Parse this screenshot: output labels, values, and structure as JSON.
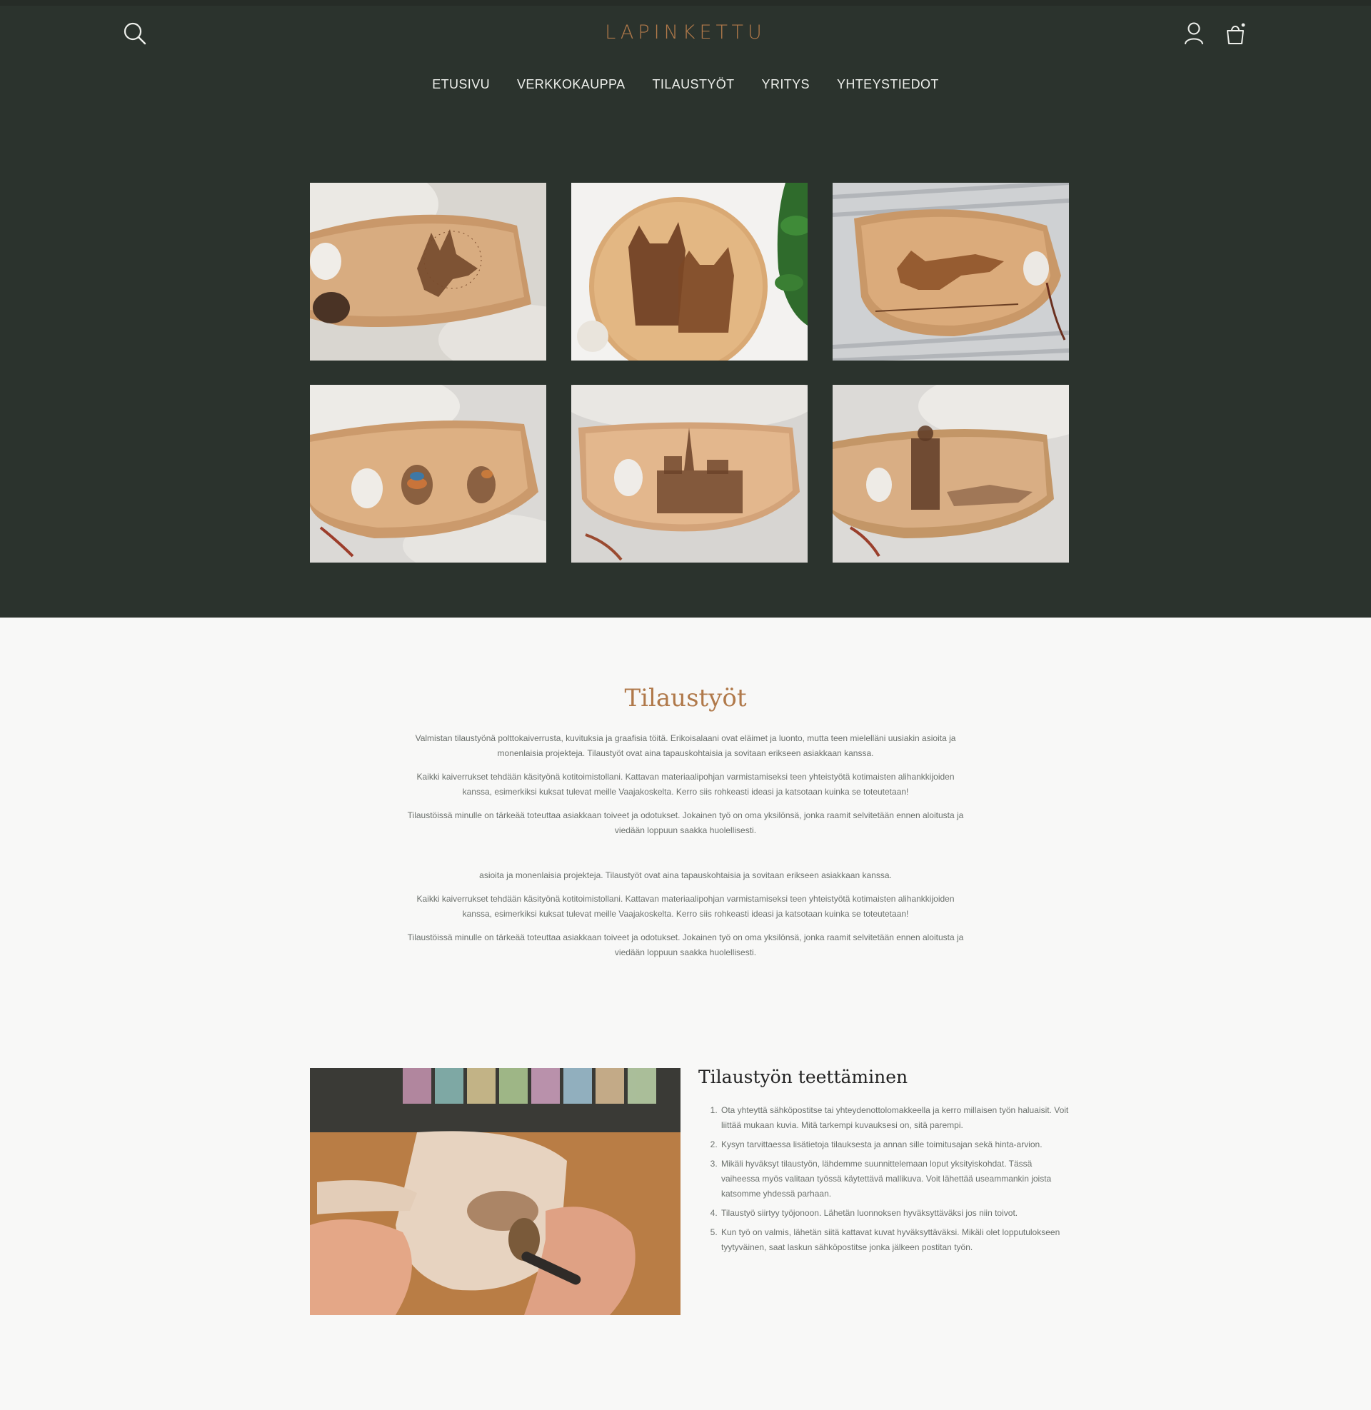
{
  "header": {
    "logo": "LAPINKETTU",
    "search_icon": "search-icon",
    "account_icon": "user-icon",
    "cart_icon": "shopping-bag-icon",
    "colors": {
      "background": "#2b332d",
      "accent": "#b0794a",
      "nav_text": "#eef0ec"
    }
  },
  "nav": {
    "items": [
      {
        "label": "ETUSIVU"
      },
      {
        "label": "VERKKOKAUPPA"
      },
      {
        "label": "TILAUSTYÖT"
      },
      {
        "label": "YRITYS"
      },
      {
        "label": "YHTEYSTIEDOT"
      }
    ]
  },
  "gallery": {
    "images": [
      {
        "subject": "kuksa-dog-engraving"
      },
      {
        "subject": "round-board-two-dogs"
      },
      {
        "subject": "kuksa-fox-running"
      },
      {
        "subject": "kuksa-two-birds"
      },
      {
        "subject": "kuksa-cathedral"
      },
      {
        "subject": "kuksa-hunter-and-dog"
      }
    ]
  },
  "intro": {
    "title": "Tilaustyöt",
    "p1": "Valmistan tilaustyönä polttokaiverrusta, kuvituksia ja graafisia töitä. Erikoisalaani ovat eläimet ja luonto, mutta teen mielelläni uusiakin asioita ja monenlaisia projekteja. Tilaustyöt ovat aina tapauskohtaisia ja sovitaan erikseen asiakkaan kanssa.",
    "p2": "Kaikki kaiverrukset tehdään käsityönä kotitoimistollani. Kattavan materiaalipohjan varmistamiseksi teen yhteistyötä kotimaisten alihankkijoiden kanssa, esimerkiksi kuksat tulevat meille Vaajakoskelta. Kerro siis rohkeasti ideasi ja katsotaan kuinka se toteutetaan!",
    "p3": "Tilaustöissä minulle on tärkeää toteuttaa asiakkaan toiveet ja odotukset. Jokainen työ on oma yksilönsä, jonka raamit selvitetään ennen aloitusta ja viedään loppuun saakka huolellisesti.",
    "p4": "asioita ja monenlaisia projekteja. Tilaustyöt ovat aina tapauskohtaisia ja sovitaan erikseen asiakkaan kanssa.",
    "p5": "Kaikki kaiverrukset tehdään käsityönä kotitoimistollani. Kattavan materiaalipohjan varmistamiseksi teen yhteistyötä kotimaisten alihankkijoiden kanssa, esimerkiksi kuksat tulevat meille Vaajakoskelta. Kerro siis rohkeasti ideasi ja katsotaan kuinka se toteutetaan!",
    "p6": "Tilaustöissä minulle on tärkeää toteuttaa asiakkaan toiveet ja odotukset. Jokainen työ on oma yksilönsä, jonka raamit selvitetään ennen aloitusta ja viedään loppuun saakka huolellisesti."
  },
  "process": {
    "title": "Tilaustyön teettäminen",
    "steps": [
      "Ota yhteyttä sähköpostitse tai yhteydenottolomakkeella ja kerro millaisen työn haluaisit. Voit liittää mukaan kuvia. Mitä tarkempi kuvauksesi on, sitä parempi.",
      "Kysyn tarvittaessa lisätietoja tilauksesta ja annan sille toimitusajan sekä hinta-arvion.",
      "Mikäli hyväksyt tilaustyön, lähdemme suunnittelemaan loput yksityiskohdat. Tässä vaiheessa myös valitaan työssä käytettävä mallikuva. Voit lähettää useammankin joista katsomme yhdessä parhaan.",
      "Tilaustyö siirtyy työjonoon. Lähetän luonnoksen hyväksyttäväksi jos niin toivot.",
      "Kun työ on valmis, lähetän siitä kattavat kuvat hyväksyttäväksi. Mikäli olet lopputulokseen tyytyväinen, saat laskun sähköpostitse jonka jälkeen postitan työn."
    ]
  }
}
